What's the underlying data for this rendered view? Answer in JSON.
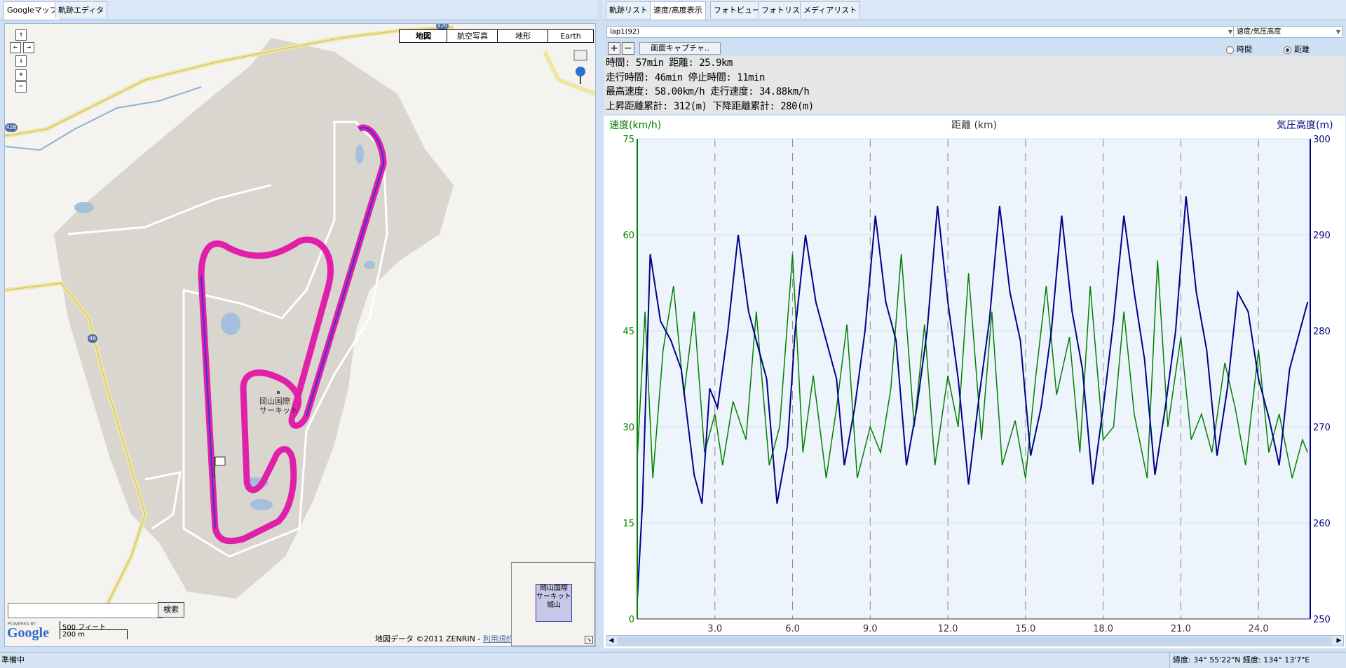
{
  "left_tabs": [
    "Googleマップ",
    "軌跡エディタ"
  ],
  "map": {
    "types": [
      "地図",
      "航空写真",
      "地形",
      "Earth"
    ],
    "selected_type": "地図",
    "nav_buttons": [
      "↑",
      "←",
      "→",
      "↓",
      "+",
      "−"
    ],
    "search_placeholder": "",
    "search_button": "検索",
    "scale_imperial": "500 フィート",
    "scale_metric": "200 m",
    "copyright": "地図データ ©2011 ZENRIN -",
    "terms": "利用規約",
    "circuit_label": "岡山国際\nサーキット",
    "mini_label": "岡山国際\nサーキット\n城山",
    "road_badges": [
      "426",
      "426",
      "46"
    ],
    "google_logo_small": "POWERED BY",
    "google_logo": "Google",
    "colors": {
      "track": "#e020a8",
      "gps": "#3535d8",
      "land": "#d9d6d0",
      "road": "#f2e8a0"
    }
  },
  "right_tabs": [
    "軌跡リスト",
    "速度/高度表示",
    "フォトビュー",
    "フォトリスト",
    "メディアリスト"
  ],
  "right_selected_tab": "速度/高度表示",
  "lap_combo": "lap1(92)",
  "mode_combo": "速度/気圧高度",
  "zoom_in": "+",
  "zoom_out": "−",
  "capture_button": "画面キャプチャ..",
  "radio_time": "時間",
  "radio_distance": "距離",
  "stats": {
    "line1": "時間: 57min 距離: 25.9km",
    "line2": "走行時間: 46min 停止時間: 11min",
    "line3": "最高速度: 58.00km/h 走行速度: 34.88km/h",
    "line4": "上昇距離累計: 312(m) 下降距離累計: 280(m)"
  },
  "status": {
    "left": "準備中",
    "right": "緯度: 34° 55'22\"N 経度: 134° 13'7\"E"
  },
  "chart_data": {
    "type": "line",
    "title": "",
    "xlabel": "距離 (km)",
    "ylabel_left": "速度(km/h)",
    "ylabel_right": "気圧高度(m)",
    "xlim": [
      0,
      26
    ],
    "ylim_left": [
      0,
      75
    ],
    "ylim_right": [
      250,
      300
    ],
    "x_ticks": [
      "3.0",
      "6.0",
      "9.0",
      "12.0",
      "15.0",
      "18.0",
      "21.0",
      "24.0"
    ],
    "y_left_ticks": [
      "0",
      "15",
      "30",
      "45",
      "60",
      "75"
    ],
    "y_right_ticks": [
      "250",
      "260",
      "270",
      "280",
      "290",
      "300"
    ],
    "grid": true,
    "series": [
      {
        "color": "#008000",
        "x": [
          0,
          0.3,
          0.6,
          1.0,
          1.4,
          1.8,
          2.2,
          2.6,
          3.0,
          3.3,
          3.7,
          4.2,
          4.6,
          5.1,
          5.5,
          6.0,
          6.4,
          6.8,
          7.3,
          7.7,
          8.1,
          8.5,
          9.0,
          9.4,
          9.8,
          10.2,
          10.7,
          11.1,
          11.5,
          12.0,
          12.4,
          12.8,
          13.3,
          13.7,
          14.1,
          14.6,
          15.0,
          15.4,
          15.8,
          16.2,
          16.7,
          17.1,
          17.5,
          18.0,
          18.4,
          18.8,
          19.2,
          19.7,
          20.1,
          20.5,
          21.0,
          21.4,
          21.8,
          22.2,
          22.7,
          23.1,
          23.5,
          24.0,
          24.4,
          24.8,
          25.3,
          25.7,
          25.9
        ],
        "y": [
          25,
          48,
          22,
          42,
          52,
          35,
          48,
          26,
          32,
          24,
          34,
          28,
          48,
          24,
          30,
          57,
          26,
          38,
          22,
          33,
          46,
          22,
          30,
          26,
          36,
          57,
          30,
          46,
          24,
          38,
          30,
          54,
          28,
          48,
          24,
          31,
          22,
          38,
          52,
          35,
          44,
          26,
          52,
          28,
          30,
          48,
          32,
          22,
          56,
          30,
          44,
          28,
          32,
          26,
          40,
          33,
          24,
          42,
          26,
          32,
          22,
          28,
          26
        ]
      },
      {
        "color": "#00008b",
        "x": [
          0,
          0.2,
          0.5,
          0.9,
          1.3,
          1.7,
          2.2,
          2.5,
          2.8,
          3.1,
          3.5,
          3.9,
          4.3,
          4.6,
          5.0,
          5.4,
          5.8,
          6.1,
          6.5,
          6.9,
          7.3,
          7.7,
          8.0,
          8.4,
          8.8,
          9.2,
          9.6,
          10.0,
          10.4,
          10.8,
          11.2,
          11.6,
          12.0,
          12.4,
          12.8,
          13.2,
          13.6,
          14.0,
          14.4,
          14.8,
          15.2,
          15.6,
          16.0,
          16.4,
          16.8,
          17.2,
          17.6,
          18.0,
          18.4,
          18.8,
          19.2,
          19.6,
          20.0,
          20.4,
          20.8,
          21.2,
          21.6,
          22.0,
          22.4,
          22.8,
          23.2,
          23.6,
          24.0,
          24.4,
          24.8,
          25.2,
          25.6,
          25.9
        ],
        "y": [
          252,
          262,
          288,
          281,
          279,
          276,
          265,
          262,
          274,
          272,
          280,
          290,
          282,
          279,
          275,
          262,
          268,
          280,
          290,
          283,
          279,
          275,
          266,
          272,
          280,
          292,
          283,
          279,
          266,
          272,
          280,
          293,
          283,
          275,
          264,
          273,
          281,
          293,
          284,
          279,
          267,
          272,
          280,
          292,
          282,
          276,
          264,
          272,
          281,
          292,
          284,
          277,
          265,
          272,
          280,
          294,
          284,
          278,
          267,
          274,
          284,
          282,
          275,
          271,
          266,
          276,
          280,
          283
        ]
      }
    ]
  }
}
